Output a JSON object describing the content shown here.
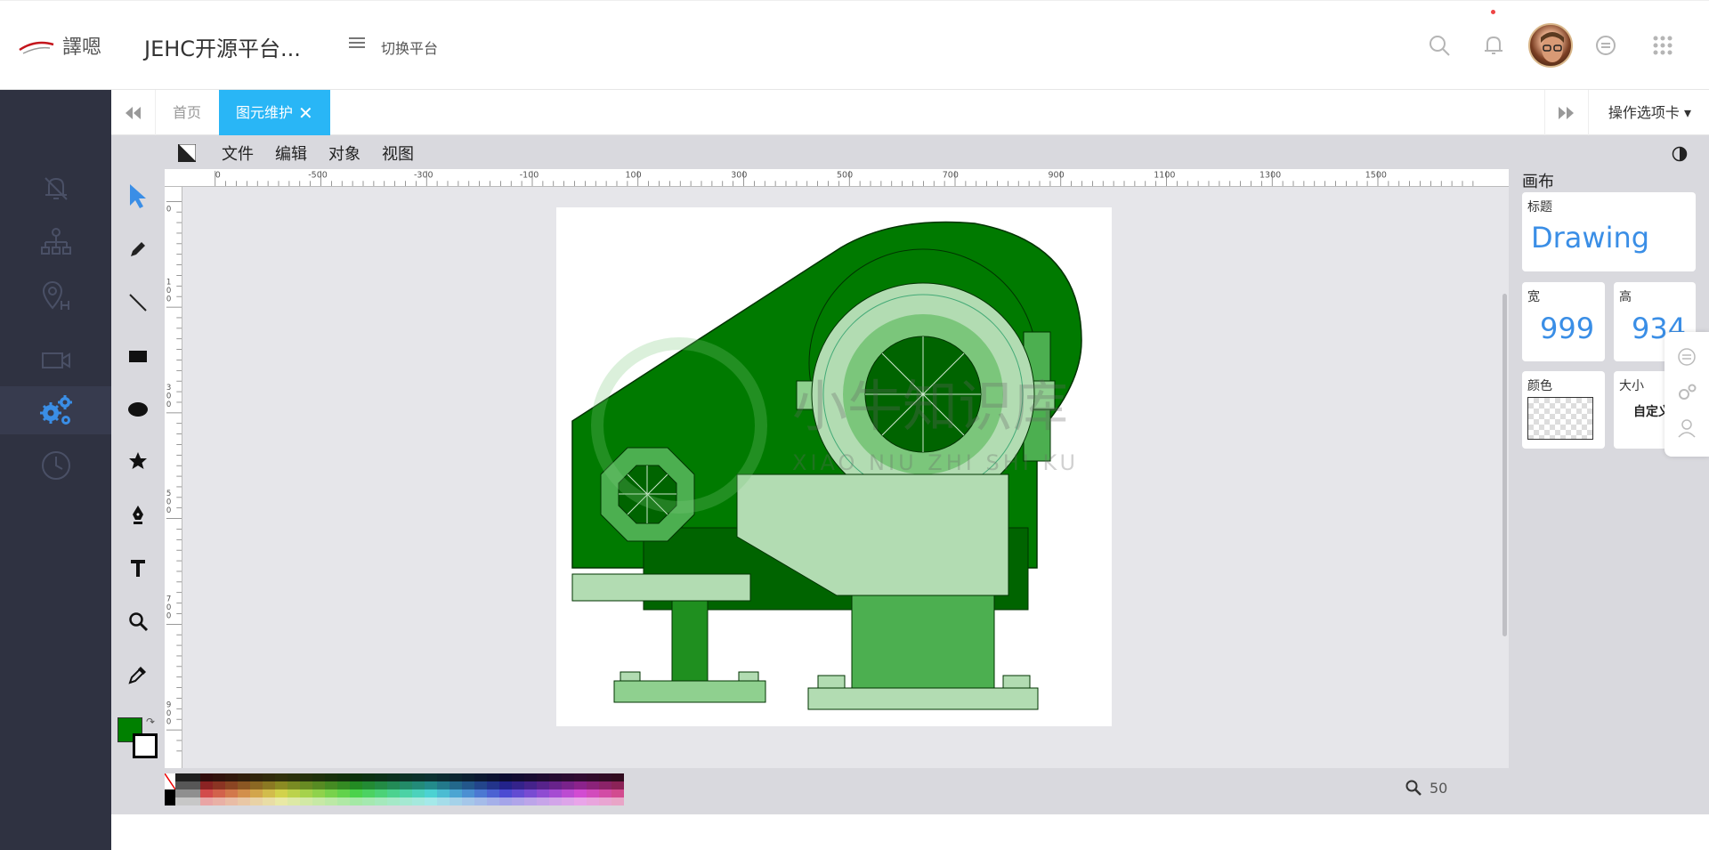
{
  "header": {
    "app_title": "JEHC开源平台...",
    "switch_label": "切换平台",
    "icons": [
      "logo-icon",
      "menu-icon",
      "search-icon",
      "bell-icon",
      "avatar",
      "message-icon",
      "apps-grid-icon"
    ]
  },
  "sidebar": {
    "items": [
      {
        "icon": "bell-icon"
      },
      {
        "icon": "org-chart-icon"
      },
      {
        "icon": "location-icon"
      },
      {
        "icon": "video-icon"
      },
      {
        "icon": "gears-icon",
        "active": true
      },
      {
        "icon": "clock-icon"
      }
    ]
  },
  "tabs": {
    "items": [
      {
        "label": "首页",
        "active": false
      },
      {
        "label": "图元维护",
        "active": true
      }
    ],
    "ops_label": "操作选项卡"
  },
  "editor": {
    "menu": [
      "文件",
      "编辑",
      "对象",
      "视图"
    ],
    "tools": [
      "select-tool",
      "pencil-tool",
      "line-tool",
      "rect-tool",
      "ellipse-tool",
      "star-tool",
      "pen-tool",
      "text-tool",
      "zoom-tool",
      "eyedropper-tool"
    ],
    "ruler_h_labels": [
      "0",
      "-500",
      "-300",
      "-100",
      "100",
      "300",
      "500",
      "700",
      "900",
      "1100",
      "1300",
      "1500"
    ],
    "ruler_v_labels": [
      "0",
      "100",
      "300",
      "500",
      "700",
      "900"
    ],
    "fill_color": "#008000",
    "stroke_color": "#000000",
    "zoom": "50"
  },
  "panel": {
    "title": "画布",
    "title_label": "标题",
    "title_value": "Drawing",
    "width_label": "宽",
    "width_value": "999",
    "height_label": "高",
    "height_value": "934",
    "color_label": "颜色",
    "size_label": "大小",
    "size_value": "自定义"
  },
  "watermark": {
    "text": "小牛知识库",
    "subtext": "XIAO NIU ZHI SHI KU"
  }
}
